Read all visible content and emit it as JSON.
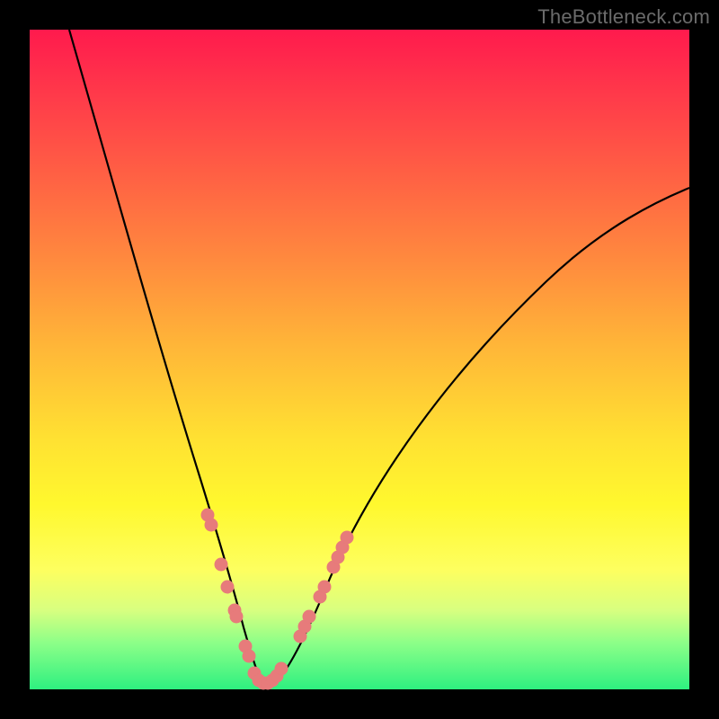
{
  "watermark": "TheBottleneck.com",
  "chart_data": {
    "type": "line",
    "title": "",
    "xlabel": "",
    "ylabel": "",
    "xlim": [
      0,
      100
    ],
    "ylim": [
      0,
      100
    ],
    "grid": false,
    "series": [
      {
        "name": "bottleneck-curve",
        "color": "#000000",
        "x": [
          6,
          10,
          14,
          18,
          22,
          25,
          27,
          29,
          31,
          32,
          33,
          34,
          35,
          36,
          37,
          39,
          41,
          44,
          48,
          54,
          62,
          72,
          84,
          96
        ],
        "values": [
          100,
          86,
          72,
          58,
          44,
          33,
          26,
          19,
          12,
          8,
          5,
          2,
          1,
          1,
          2,
          4,
          8,
          14,
          22,
          33,
          46,
          58,
          68,
          76
        ]
      },
      {
        "name": "datapoint-markers",
        "color": "#e77b7b",
        "marker": "circle",
        "x": [
          27.0,
          27.5,
          29.0,
          30.0,
          31.0,
          31.3,
          32.7,
          33.3,
          34.0,
          34.7,
          35.4,
          36.1,
          36.8,
          37.5,
          38.2,
          41.0,
          41.7,
          42.4,
          44.0,
          44.7,
          46.0,
          46.7,
          47.4,
          48.1
        ],
        "values": [
          26.5,
          25.0,
          19.0,
          15.5,
          12.0,
          11.0,
          6.5,
          5.0,
          2.5,
          1.3,
          1.0,
          1.0,
          1.3,
          2.0,
          3.2,
          8.0,
          9.5,
          11.0,
          14.0,
          15.5,
          18.5,
          20.0,
          21.5,
          23.0
        ]
      }
    ],
    "background_gradient": {
      "top": "#ff1a4d",
      "mid": "#ffe132",
      "bottom": "#2ef080"
    }
  }
}
